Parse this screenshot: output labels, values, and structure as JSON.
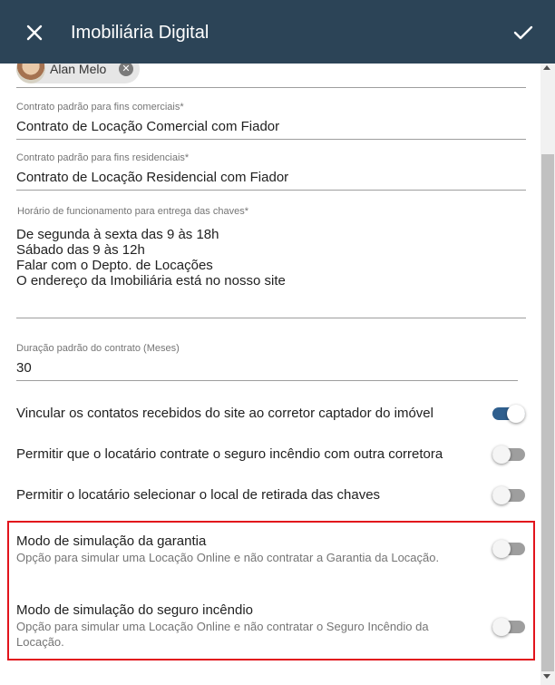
{
  "header": {
    "title": "Imobiliária Digital",
    "close_icon": "close-icon",
    "confirm_icon": "check-icon",
    "background": "#2c4457"
  },
  "chip": {
    "label": "Alan Melo",
    "remove_icon": "cancel-circle-icon"
  },
  "fields": {
    "commercial": {
      "label": "Contrato padrão para fins comerciais*",
      "value": "Contrato de Locação Comercial com Fiador"
    },
    "residential": {
      "label": "Contrato padrão para fins residenciais*",
      "value": "Contrato de Locação Residencial com Fiador"
    },
    "hours": {
      "label": "Horário de funcionamento para entrega das chaves*",
      "lines": [
        "De segunda à sexta das 9 às 18h",
        "Sábado das 9 às 12h",
        "Falar com o Depto. de Locações",
        "O endereço da Imobiliária está no nosso site"
      ]
    },
    "duration": {
      "label": "Duração padrão do contrato (Meses)",
      "value": "30"
    }
  },
  "toggles": [
    {
      "label": "Vincular os contatos recebidos do site ao corretor captador do imóvel",
      "on": true
    },
    {
      "label": "Permitir que o locatário contrate o seguro incêndio com outra corretora",
      "on": false
    },
    {
      "label": "Permitir o locatário selecionar o local de retirada das chaves",
      "on": false
    },
    {
      "label": "Modo de simulação da garantia",
      "description": "Opção para simular uma Locação Online e não contratar a Garantia da Locação.",
      "on": false
    },
    {
      "label": "Modo de simulação do seguro incêndio",
      "description": "Opção para simular uma Locação Online e não contratar o Seguro Incêndio da Locação.",
      "on": false
    }
  ],
  "colors": {
    "toggle_on": "#2f5f8e",
    "highlight_border": "#e2141c"
  }
}
